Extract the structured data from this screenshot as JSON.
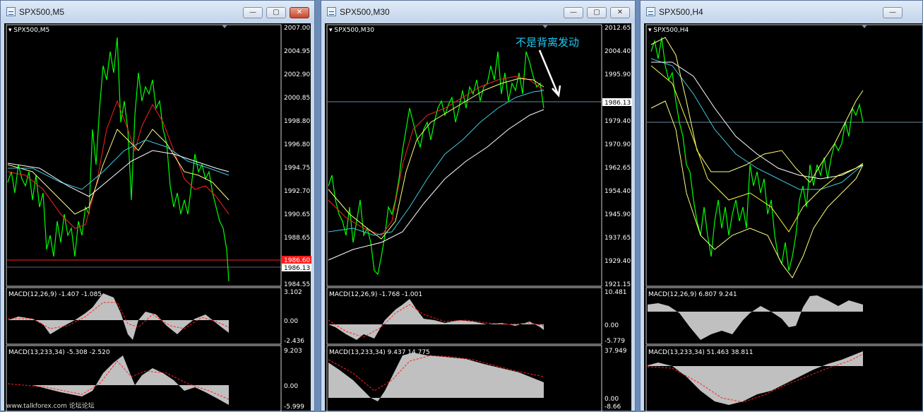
{
  "windows": [
    {
      "title": "SPX500,M5",
      "chart_label": "SPX500,M5",
      "price_ticks": [
        "2007.00",
        "2004.95",
        "2002.90",
        "2000.85",
        "1998.80",
        "1996.80",
        "1994.75",
        "1992.70",
        "1990.65",
        "1988.65",
        "1986.60",
        "1984.55"
      ],
      "current_price": "1986.13",
      "bid_price": "1986.60",
      "macd1": {
        "label": "MACD(12,26,9) -1.407 -1.085",
        "ticks": [
          "3.102",
          "0.00",
          "-2.436"
        ]
      },
      "macd2": {
        "label": "MACD(13,233,34) -5.308 -2.520",
        "ticks": [
          "9.203",
          "0.00",
          "-5.999"
        ]
      },
      "close_active": true
    },
    {
      "title": "SPX500,M30",
      "chart_label": "SPX500,M30",
      "price_ticks": [
        "2012.65",
        "2004.40",
        "1995.90",
        "1987.65",
        "1979.40",
        "1970.90",
        "1962.65",
        "1954.40",
        "1945.90",
        "1937.65",
        "1929.40",
        "1921.15"
      ],
      "current_price": "1986.13",
      "annotation": "不是背离发动",
      "macd1": {
        "label": "MACD(12,26,9) -1.768 -1.001",
        "ticks": [
          "10.481",
          "0.00",
          "-5.779"
        ]
      },
      "macd2": {
        "label": "MACD(13,233,34) 9.437 14.775",
        "ticks": [
          "37.949",
          "0.00",
          "-8.66"
        ]
      },
      "close_active": false
    },
    {
      "title": "SPX500,H4",
      "chart_label": "SPX500,H4",
      "macd1": {
        "label": "MACD(12,26,9) 6.807 9.241"
      },
      "macd2": {
        "label": "MACD(13,233,34) 51.463 38.811"
      },
      "close_active": false
    }
  ],
  "buttons": {
    "minimize": "—",
    "maximize": "▢",
    "close": "✕"
  },
  "watermark": "www.talkforex.com 论坛论坛",
  "colors": {
    "price": "#00ff00",
    "ma_red": "#ff2020",
    "ma_yellow": "#ffff80",
    "ma_cyan": "#40c8e0",
    "ma_white": "#ffffff",
    "macd_hist": "#c0c0c0",
    "macd_signal": "#ff2020",
    "annotation": "#20c8f0"
  }
}
